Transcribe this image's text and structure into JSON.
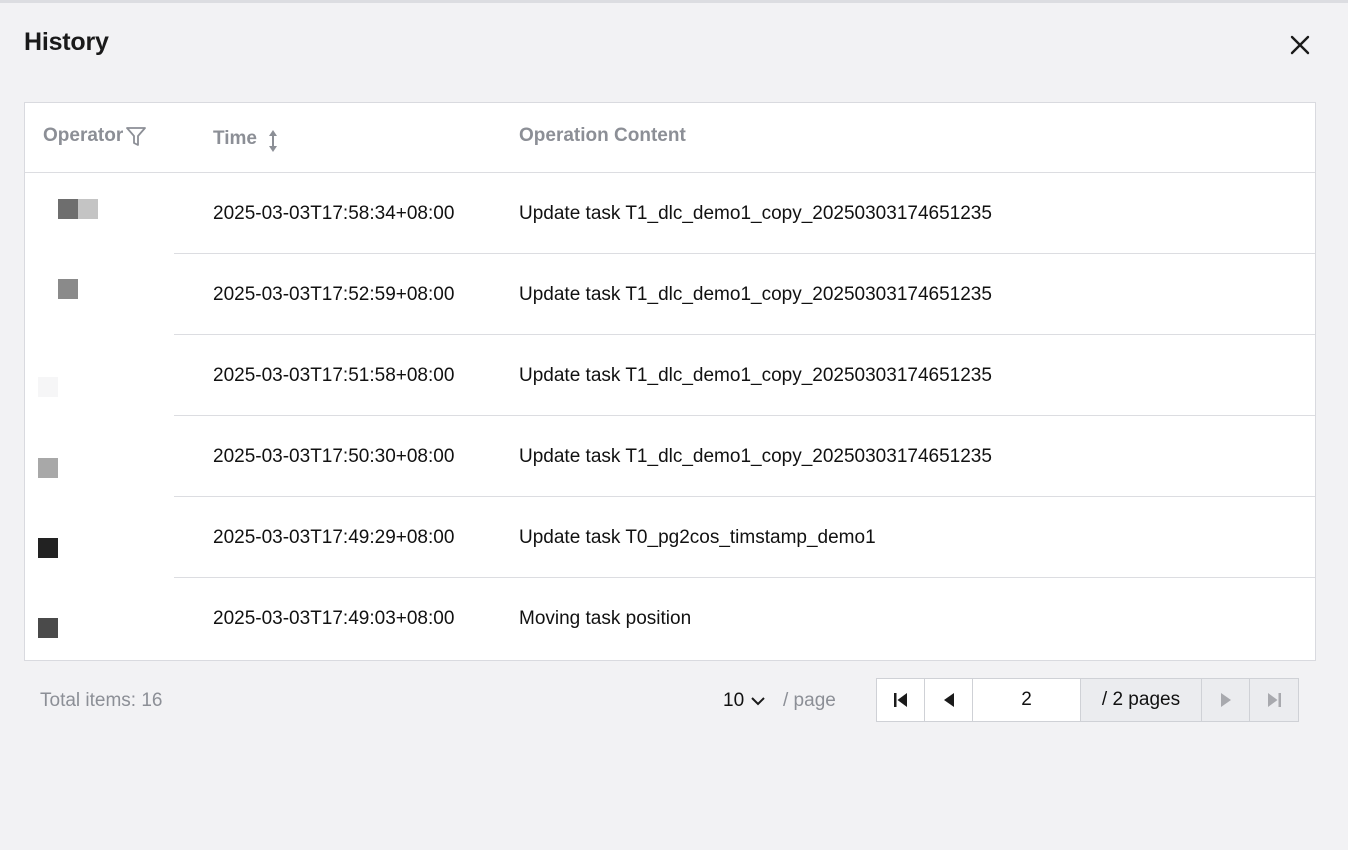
{
  "dialog": {
    "title": "History",
    "close_icon": "close-icon"
  },
  "table": {
    "columns": {
      "operator": "Operator",
      "time": "Time",
      "content": "Operation Content"
    },
    "rows": [
      {
        "time": "2025-03-03T17:58:34+08:00",
        "content": "Update task T1_dlc_demo1_copy_20250303174651235"
      },
      {
        "time": "2025-03-03T17:52:59+08:00",
        "content": "Update task T1_dlc_demo1_copy_20250303174651235"
      },
      {
        "time": "2025-03-03T17:51:58+08:00",
        "content": "Update task T1_dlc_demo1_copy_20250303174651235"
      },
      {
        "time": "2025-03-03T17:50:30+08:00",
        "content": "Update task T1_dlc_demo1_copy_20250303174651235"
      },
      {
        "time": "2025-03-03T17:49:29+08:00",
        "content": "Update task T0_pg2cos_timstamp_demo1"
      },
      {
        "time": "2025-03-03T17:49:03+08:00",
        "content": "Moving task position"
      }
    ]
  },
  "footer": {
    "total_label": "Total items:  16",
    "page_size": "10",
    "per_page": "/ page",
    "current_page": "2",
    "total_pages": "/ 2 pages"
  },
  "colors": {
    "background": "#f2f2f4",
    "header_text": "#8c8f96",
    "border": "#d9dadf"
  }
}
